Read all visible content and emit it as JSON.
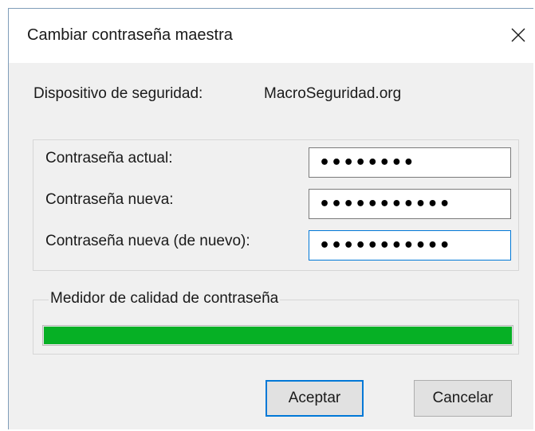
{
  "dialog": {
    "title": "Cambiar contraseña maestra",
    "close_icon": "close-icon"
  },
  "device": {
    "label": "Dispositivo de seguridad:",
    "value": "MacroSeguridad.org"
  },
  "fields": [
    {
      "label": "Contraseña actual:",
      "value": "********"
    },
    {
      "label": "Contraseña nueva:",
      "value": "***********"
    },
    {
      "label": "Contraseña nueva (de nuevo):",
      "value": "***********"
    }
  ],
  "meter": {
    "legend": "Medidor de calidad de contraseña",
    "level_percent": 100,
    "color": "#06b025"
  },
  "buttons": {
    "accept": "Aceptar",
    "cancel": "Cancelar"
  },
  "colors": {
    "focus_accent": "#0078d7"
  }
}
